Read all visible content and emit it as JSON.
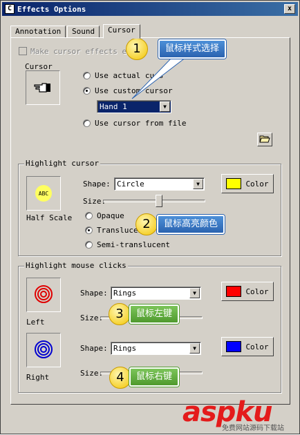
{
  "window": {
    "title": "Effects Options",
    "close_label": "x"
  },
  "tabs": [
    {
      "label": "Annotation"
    },
    {
      "label": "Sound"
    },
    {
      "label": "Cursor"
    }
  ],
  "make_effects": {
    "label": "Make cursor effects ed"
  },
  "cursor_group": {
    "label": "Cursor",
    "use_actual": "Use actual curs",
    "use_custom": "Use custom cursor",
    "cursor_select": "Hand 1",
    "use_file": "Use cursor from file"
  },
  "highlight_cursor": {
    "label": "Highlight cursor",
    "preview_text": "ABC",
    "half_scale": "Half Scale",
    "shape_label": "Shape:",
    "shape_value": "Circle",
    "color_button": "Color",
    "color": "#ffff00",
    "size_label": "Size:",
    "opaque": "Opaque",
    "translucent": "Translucen",
    "semi": "Semi-translucent"
  },
  "highlight_clicks": {
    "label": "Highlight mouse clicks",
    "left": {
      "caption": "Left",
      "shape_label": "Shape:",
      "shape_value": "Rings",
      "color_button": "Color",
      "color": "#ff0000",
      "size_label": "Size:"
    },
    "right": {
      "caption": "Right",
      "shape_label": "Shape:",
      "shape_value": "Rings",
      "color_button": "Color",
      "color": "#0000ff",
      "size_label": "Size:"
    }
  },
  "callouts": [
    {
      "num": "1",
      "text": "鼠标样式选择"
    },
    {
      "num": "2",
      "text": "鼠标高亮颜色"
    },
    {
      "num": "3",
      "text": "鼠标左键"
    },
    {
      "num": "4",
      "text": "鼠标右键"
    }
  ],
  "watermark": {
    "brand": "aspku",
    "sub": "免费网站源码下载站"
  }
}
